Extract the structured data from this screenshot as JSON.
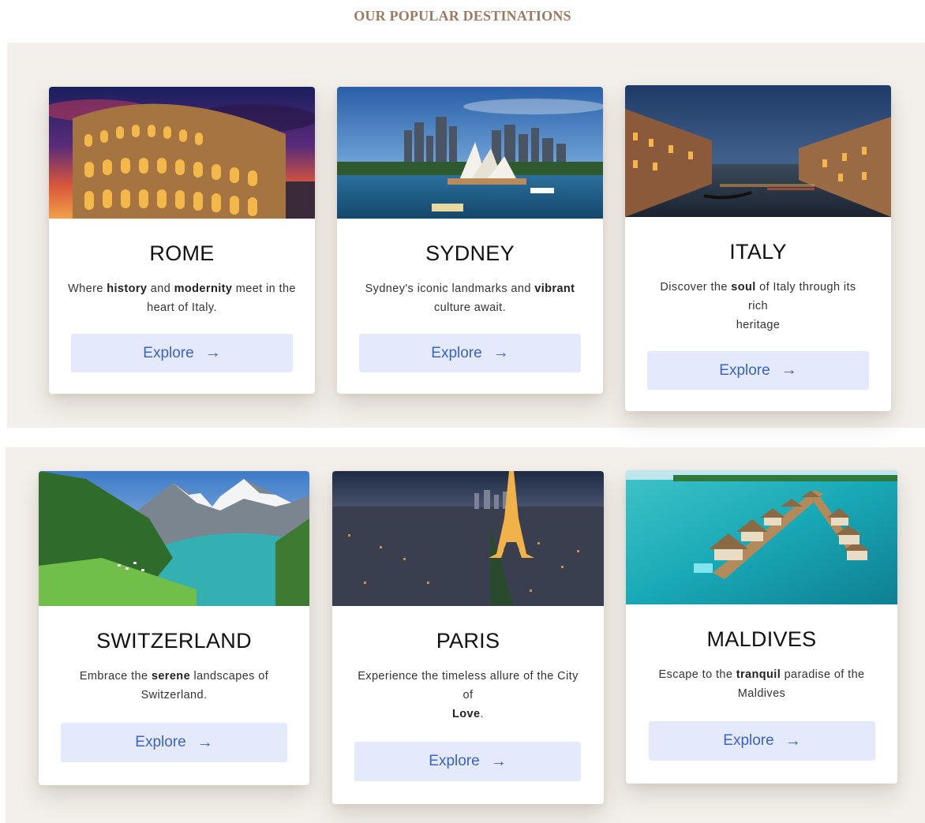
{
  "section": {
    "title": "OUR POPULAR DESTINATIONS"
  },
  "explore_label": "Explore",
  "arrow": "→",
  "cards": [
    {
      "city": "ROME",
      "desc": [
        {
          "t": "Where "
        },
        {
          "b": "history"
        },
        {
          "t": " and "
        },
        {
          "b": "modernity"
        },
        {
          "t": " meet in the heart of Italy."
        }
      ],
      "image": "colosseum-at-dusk"
    },
    {
      "city": "SYDNEY",
      "desc": [
        {
          "t": "Sydney's iconic landmarks and "
        },
        {
          "b": "vibrant"
        },
        {
          "t": " culture await."
        }
      ],
      "image": "sydney-opera-house-harbour"
    },
    {
      "city": "ITALY",
      "desc": [
        {
          "t": "Discover the "
        },
        {
          "b": "soul"
        },
        {
          "t": " of Italy through its rich"
        },
        {
          "br": true
        },
        {
          "t": "heritage"
        }
      ],
      "image": "venice-grand-canal-night"
    },
    {
      "city": "SWITZERLAND",
      "desc": [
        {
          "t": "Embrace the "
        },
        {
          "b": "serene"
        },
        {
          "t": " landscapes of Switzerland."
        }
      ],
      "image": "alpine-lake-mountains"
    },
    {
      "city": "PARIS",
      "desc": [
        {
          "t": "Experience the timeless allure of the City of"
        },
        {
          "br": true
        },
        {
          "b": "Love"
        },
        {
          "t": "."
        }
      ],
      "image": "eiffel-tower-city-evening"
    },
    {
      "city": "MALDIVES",
      "desc": [
        {
          "t": "Escape to the "
        },
        {
          "b": "tranquil"
        },
        {
          "t": " paradise of the Maldives"
        }
      ],
      "image": "overwater-bungalows-lagoon"
    }
  ],
  "colors": {
    "title": "#9c7a62",
    "band": "#f3efea",
    "button_bg": "#e4eafb",
    "button_text": "#3b62c8"
  }
}
